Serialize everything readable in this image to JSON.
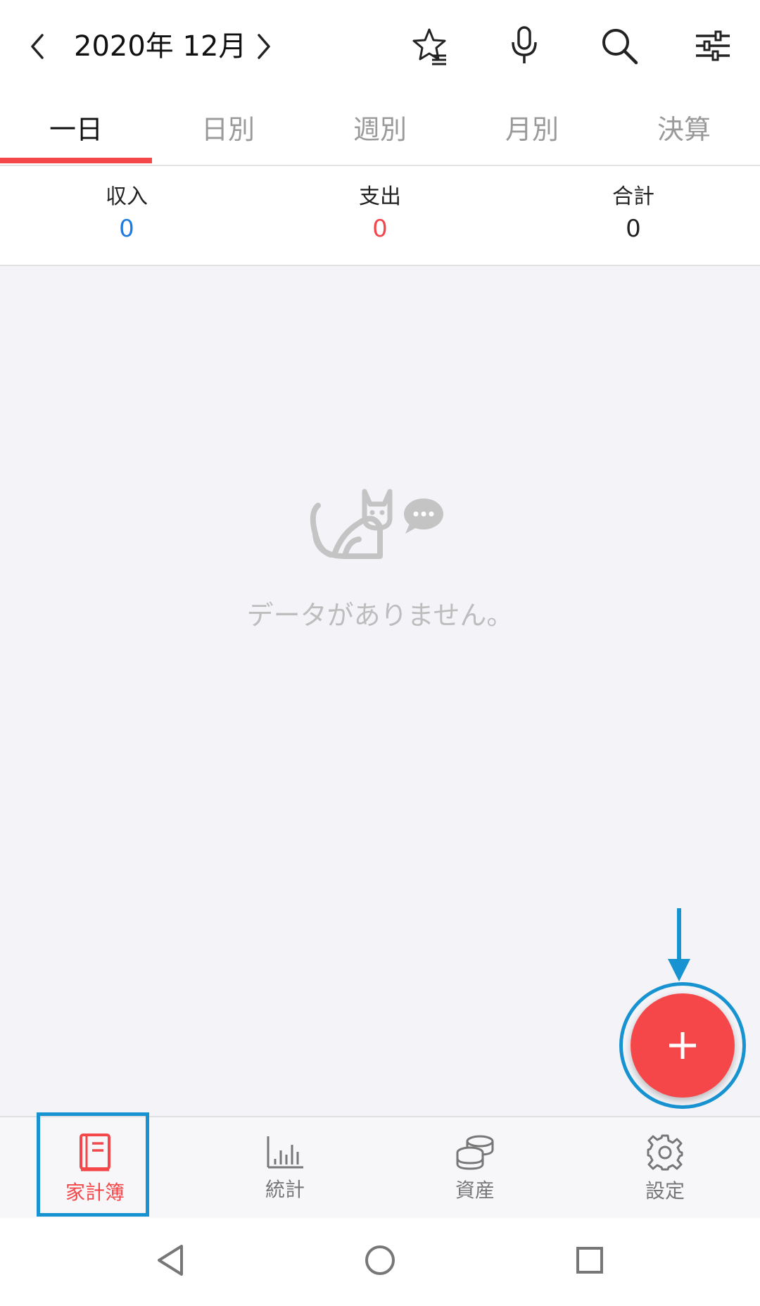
{
  "header": {
    "month": "2020年 12月",
    "icons": [
      "chevron-left-icon",
      "chevron-right-icon",
      "bookmark-star-icon",
      "microphone-icon",
      "search-icon",
      "filter-sliders-icon"
    ]
  },
  "tabs": [
    {
      "label": "一日",
      "active": true
    },
    {
      "label": "日別",
      "active": false
    },
    {
      "label": "週別",
      "active": false
    },
    {
      "label": "月別",
      "active": false
    },
    {
      "label": "決算",
      "active": false
    }
  ],
  "summary": {
    "income_label": "収入",
    "income_value": "0",
    "expense_label": "支出",
    "expense_value": "0",
    "total_label": "合計",
    "total_value": "0"
  },
  "empty_state": {
    "message": "データがありません。",
    "icon": "cat-chat-icon"
  },
  "fab": {
    "icon": "plus-icon"
  },
  "bottom_nav": [
    {
      "label": "家計簿",
      "icon": "book-icon",
      "active": true
    },
    {
      "label": "統計",
      "icon": "bar-chart-icon",
      "active": false
    },
    {
      "label": "資産",
      "icon": "coins-icon",
      "active": false
    },
    {
      "label": "設定",
      "icon": "gear-icon",
      "active": false
    }
  ],
  "colors": {
    "accent_red": "#f3474a",
    "income_blue": "#1e7be0",
    "highlight_blue": "#1793d1",
    "empty_gray": "#bdbdbd"
  }
}
